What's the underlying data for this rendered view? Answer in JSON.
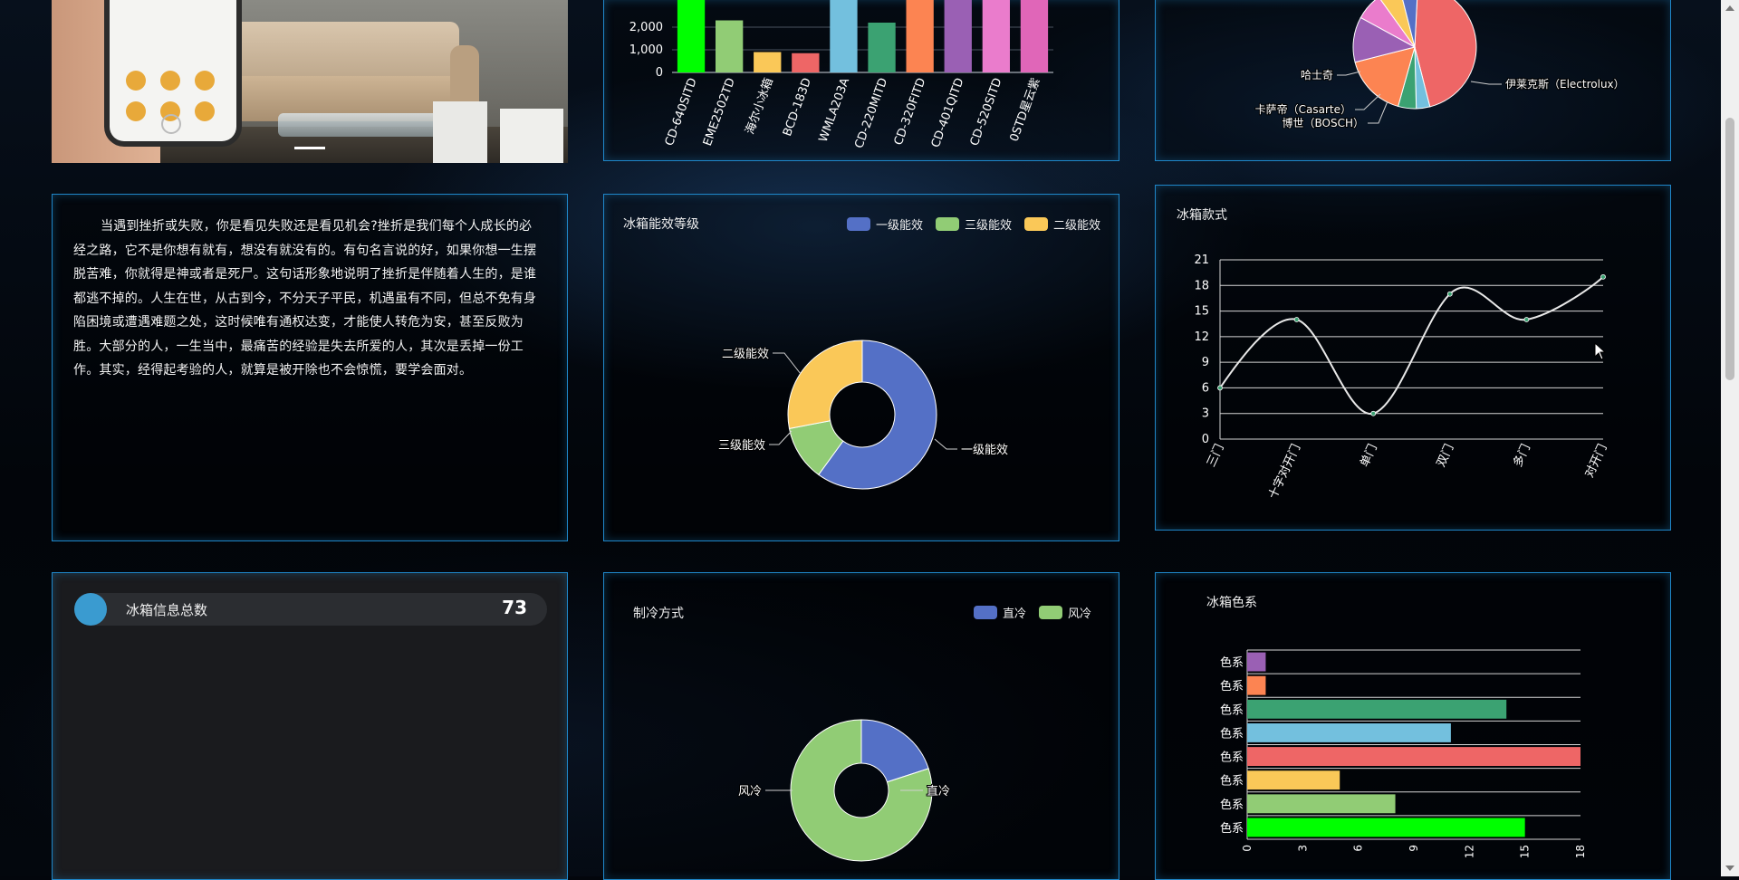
{
  "essay": {
    "text": "当遇到挫折或失败，你是看见失败还是看见机会?挫折是我们每个人成长的必经之路，它不是你想有就有，想没有就没有的。有句名言说的好，如果你想一生摆脱苦难，你就得是神或者是死尸。这句话形象地说明了挫折是伴随着人生的，是谁都逃不掉的。人生在世，从古到今，不分天子平民，机遇虽有不同，但总不免有身陷困境或遭遇难题之处，这时候唯有通权达变，才能使人转危为安，甚至反败为胜。大部分的人，一生当中，最痛苦的经验是失去所爱的人，其次是丢掉一份工作。其实，经得起考验的人，就算是被开除也不会惊慌，要学会面对。"
  },
  "stat": {
    "label": "冰箱信息总数",
    "value": "73"
  },
  "colors": {
    "blue": "#5470c6",
    "green": "#91cc75",
    "yellow": "#fac858",
    "red": "#ee6666",
    "cyan": "#73c0de",
    "teal": "#3ba272",
    "orange": "#fc8452",
    "purple": "#9a60b4",
    "pink": "#ea7ccc",
    "lime": "#00ff00",
    "panel_border": "#1f86c8"
  },
  "chart_data": [
    {
      "id": "models",
      "type": "bar",
      "categories": [
        "CD-640SITD",
        "EME2502TD",
        "海尔小冰箱",
        "BCD-183D",
        "WMLA203A",
        "CD-220MITD",
        "CD-320FITD",
        "CD-401QITD",
        "CD-520SITD",
        "0STD星云紫"
      ],
      "values": [
        3600,
        2300,
        900,
        850,
        4000,
        2200,
        3600,
        3700,
        3600,
        3600
      ],
      "bar_colors": [
        "#00ff00",
        "#91cc75",
        "#fac858",
        "#ee6666",
        "#73c0de",
        "#3ba272",
        "#fc8452",
        "#9a60b4",
        "#ea7ccc",
        "#e066b8"
      ],
      "yticks": [
        "0",
        "1,000",
        "2,000"
      ],
      "ylim": [
        0,
        4000
      ]
    },
    {
      "id": "brands",
      "type": "pie",
      "labels": [
        "伊莱克斯（Electrolux）",
        "博世（BOSCH）",
        "卡萨帝（Casarte）",
        "哈士奇"
      ],
      "values": [
        38,
        3,
        4,
        14,
        10,
        6,
        5,
        4
      ],
      "slice_colors": [
        "#ee6666",
        "#73c0de",
        "#3ba272",
        "#fc8452",
        "#9a60b4",
        "#ea7ccc",
        "#fac858",
        "#5470c6"
      ]
    },
    {
      "id": "energy",
      "type": "pie",
      "title": "冰箱能效等级",
      "legend": [
        "一级能效",
        "三级能效",
        "二级能效"
      ],
      "labels": [
        "一级能效",
        "三级能效",
        "二级能效"
      ],
      "values": [
        60,
        12,
        28
      ],
      "slice_colors": [
        "#5470c6",
        "#91cc75",
        "#fac858"
      ]
    },
    {
      "id": "styles",
      "type": "line",
      "title": "冰箱款式",
      "categories": [
        "三门",
        "十字对开门",
        "单门",
        "双门",
        "多门",
        "对开门"
      ],
      "values": [
        6,
        14,
        3,
        17,
        14,
        19
      ],
      "yticks": [
        "0",
        "3",
        "6",
        "9",
        "12",
        "15",
        "18",
        "21"
      ],
      "ylim": [
        0,
        21
      ],
      "grid": true
    },
    {
      "id": "cooling",
      "type": "pie",
      "title": "制冷方式",
      "legend": [
        "直冷",
        "风冷"
      ],
      "labels": [
        "直冷",
        "风冷"
      ],
      "values": [
        20,
        80
      ],
      "slice_colors": [
        "#5470c6",
        "#91cc75"
      ]
    },
    {
      "id": "color",
      "type": "bar",
      "orientation": "horizontal",
      "title": "冰箱色系",
      "categories": [
        "色系",
        "色系",
        "色系",
        "色系",
        "色系",
        "色系",
        "色系",
        "色系"
      ],
      "values": [
        15,
        8,
        5,
        18,
        11,
        14,
        1,
        1
      ],
      "bar_colors": [
        "#00ff00",
        "#91cc75",
        "#fac858",
        "#ee6666",
        "#73c0de",
        "#3ba272",
        "#fc8452",
        "#9a60b4"
      ],
      "xticks": [
        "0",
        "3",
        "6",
        "9",
        "12",
        "15",
        "18"
      ],
      "xlim": [
        0,
        18
      ]
    }
  ]
}
